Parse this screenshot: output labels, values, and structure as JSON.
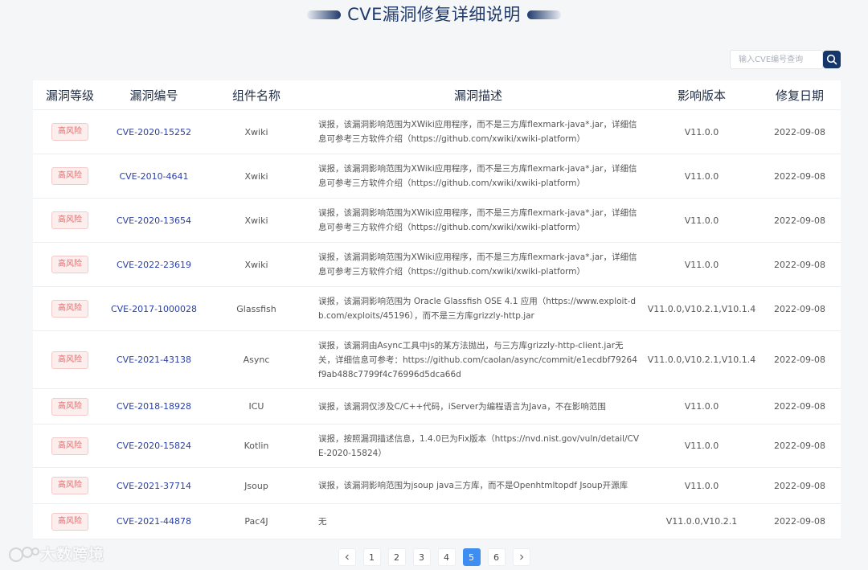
{
  "header": {
    "title": "CVE漏洞修复详细说明"
  },
  "search": {
    "placeholder": "输入CVE编号查询"
  },
  "table": {
    "columns": [
      "漏洞等级",
      "漏洞编号",
      "组件名称",
      "漏洞描述",
      "影响版本",
      "修复日期"
    ],
    "rows": [
      {
        "level": "高风险",
        "cve": "CVE-2020-15252",
        "component": "Xwiki",
        "desc": "误报，该漏洞影响范围为XWiki应用程序，而不是三方库flexmark-java*.jar，详细信息可参考三方软件介绍（https://github.com/xwiki/xwiki-platform）",
        "version": "V11.0.0",
        "date": "2022-09-08"
      },
      {
        "level": "高风险",
        "cve": "CVE-2010-4641",
        "component": "Xwiki",
        "desc": "误报，该漏洞影响范围为XWiki应用程序，而不是三方库flexmark-java*.jar，详细信息可参考三方软件介绍（https://github.com/xwiki/xwiki-platform）",
        "version": "V11.0.0",
        "date": "2022-09-08"
      },
      {
        "level": "高风险",
        "cve": "CVE-2020-13654",
        "component": "Xwiki",
        "desc": "误报，该漏洞影响范围为XWiki应用程序，而不是三方库flexmark-java*.jar，详细信息可参考三方软件介绍（https://github.com/xwiki/xwiki-platform）",
        "version": "V11.0.0",
        "date": "2022-09-08"
      },
      {
        "level": "高风险",
        "cve": "CVE-2022-23619",
        "component": "Xwiki",
        "desc": "误报，该漏洞影响范围为XWiki应用程序，而不是三方库flexmark-java*.jar，详细信息可参考三方软件介绍（https://github.com/xwiki/xwiki-platform）",
        "version": "V11.0.0",
        "date": "2022-09-08"
      },
      {
        "level": "高风险",
        "cve": "CVE-2017-1000028",
        "component": "Glassfish",
        "desc": "误报，该漏洞影响范围为 Oracle Glassfish OSE 4.1 应用（https://www.exploit-db.com/exploits/45196），而不是三方库grizzly-http.jar",
        "version": "V11.0.0,V10.2.1,V10.1.4",
        "date": "2022-09-08"
      },
      {
        "level": "高风险",
        "cve": "CVE-2021-43138",
        "component": "Async",
        "desc": "误报，该漏洞由Async工具中js的某方法抛出，与三方库grizzly-http-client.jar无关，详细信息可参考：https://github.com/caolan/async/commit/e1ecdbf79264f9ab488c7799f4c76996d5dca66d",
        "version": "V11.0.0,V10.2.1,V10.1.4",
        "date": "2022-09-08"
      },
      {
        "level": "高风险",
        "cve": "CVE-2018-18928",
        "component": "ICU",
        "desc": "误报，该漏洞仅涉及C/C++代码，iServer为编程语言为Java，不在影响范围",
        "version": "V11.0.0",
        "date": "2022-09-08"
      },
      {
        "level": "高风险",
        "cve": "CVE-2020-15824",
        "component": "Kotlin",
        "desc": "误报，按照漏洞描述信息，1.4.0已为Fix版本（https://nvd.nist.gov/vuln/detail/CVE-2020-15824）",
        "version": "V11.0.0",
        "date": "2022-09-08"
      },
      {
        "level": "高风险",
        "cve": "CVE-2021-37714",
        "component": "Jsoup",
        "desc": "误报，该漏洞影响范围为jsoup java三方库，而不是Openhtmltopdf Jsoup开源库",
        "version": "V11.0.0",
        "date": "2022-09-08"
      },
      {
        "level": "高风险",
        "cve": "CVE-2021-44878",
        "component": "Pac4J",
        "desc": "无",
        "version": "V11.0.0,V10.2.1",
        "date": "2022-09-08"
      }
    ]
  },
  "pagination": {
    "prev_icon": "chevron-left-icon",
    "next_icon": "chevron-right-icon",
    "pages": [
      "1",
      "2",
      "3",
      "4",
      "5",
      "6"
    ],
    "active": "5"
  },
  "watermark": {
    "text": "大数跨境"
  },
  "colors": {
    "title": "#1f3a6b",
    "badge": "#e46a6a",
    "link": "#2a3fa8",
    "active_page": "#3d8ef0",
    "search_button": "#14366a"
  }
}
